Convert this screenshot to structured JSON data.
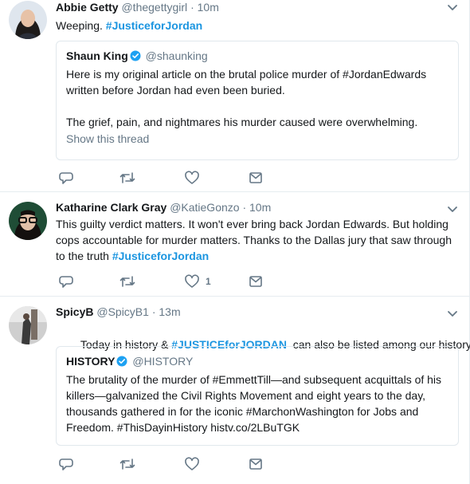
{
  "tweets": [
    {
      "fullname": "Abbie Getty",
      "username": "@thegettygirl",
      "dot": "·",
      "time": "10m",
      "text_plain": "Weeping. ",
      "text_hashtag": "#JusticeforJordan",
      "quote": {
        "fullname": "Shaun King",
        "username": "@shaunking",
        "line1": "Here is my original article on the brutal police murder of #JordanEdwards",
        "line2": "written before Jordan had even been buried.",
        "line3": "The grief, pain, and nightmares his murder caused were overwhelming.",
        "show_thread": "Show this thread"
      },
      "like_count": ""
    },
    {
      "fullname": "Katharine Clark Gray",
      "username": "@KatieGonzo",
      "dot": "·",
      "time": "10m",
      "line1": "This guilty verdict matters. It won't ever bring back Jordan Edwards. But holding",
      "line2": "cops accountable for murder matters. Thanks to the Dallas jury that saw through",
      "line3_plain": "to the truth ",
      "line3_hashtag": "#JusticeforJordan",
      "like_count": "1"
    },
    {
      "fullname": "SpicyB",
      "username": "@SpicyB1",
      "dot": "·",
      "time": "13m",
      "text_plain1": "Today in history & ",
      "text_hashtag": "#JUSTICEforJORDAN",
      "text_plain2": "  can also be listed among our history..",
      "quote": {
        "fullname": "HISTORY",
        "username": "@HISTORY",
        "line1": "The brutality of the murder of #EmmettTill—and subsequent acquittals of his",
        "line2": "killers—galvanized the Civil Rights Movement and eight years to the day,",
        "line3": "thousands gathered in for the iconic #MarchonWashington for Jobs and",
        "line4": "Freedom. #ThisDayinHistory histv.co/2LBuTGK"
      },
      "like_count": ""
    }
  ],
  "icons": {
    "reply": "reply-icon",
    "retweet": "retweet-icon",
    "like": "heart-icon",
    "dm": "envelope-icon",
    "caret": "chevron-down-icon",
    "verified": "verified-badge-icon"
  },
  "colors": {
    "hashtag": "#1b95e0",
    "secondary": "#657786",
    "verified": "#1da1f2"
  }
}
